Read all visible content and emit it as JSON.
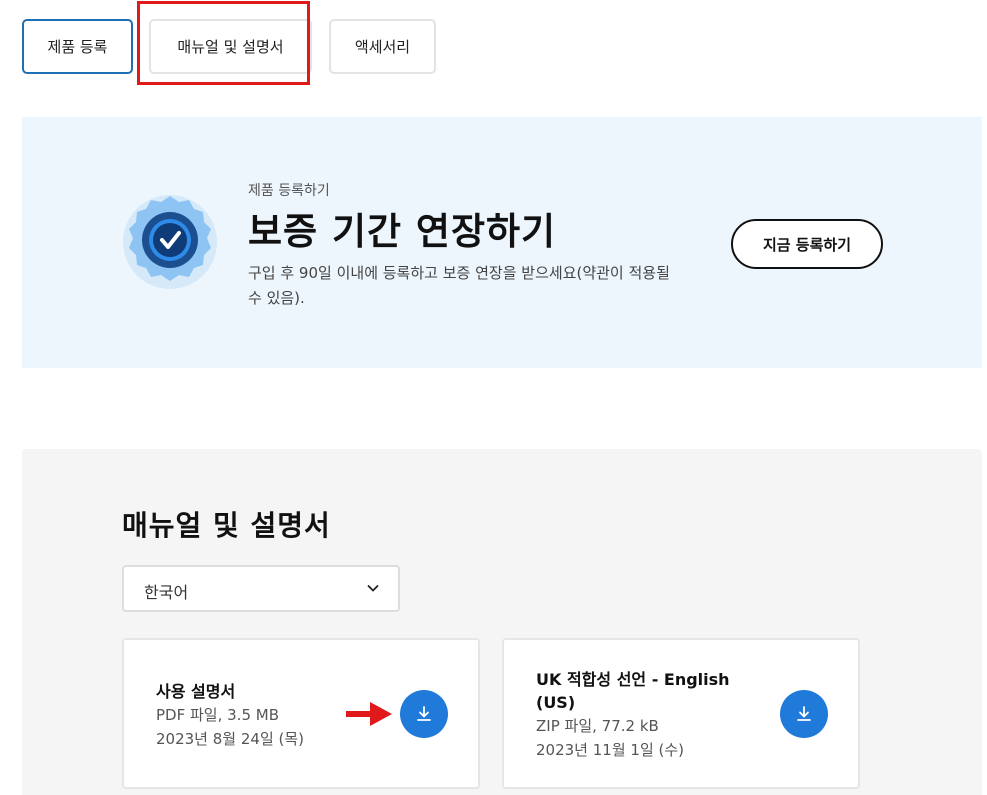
{
  "tabs": [
    {
      "label": "제품 등록",
      "active": true
    },
    {
      "label": "매뉴얼 및 설명서",
      "active": false
    },
    {
      "label": "액세서리",
      "active": false
    }
  ],
  "promo": {
    "eyebrow": "제품 등록하기",
    "title": "보증 기간 연장하기",
    "description": "구입 후 90일 이내에 등록하고 보증 연장을 받으세요(약관이 적용될 수 있음).",
    "button_label": "지금 등록하기",
    "badge_icon": "verified-check-icon"
  },
  "manuals": {
    "title": "매뉴얼 및 설명서",
    "language_select": {
      "value": "한국어",
      "icon": "chevron-down-icon"
    },
    "documents": [
      {
        "title": "사용 설명서",
        "file_info": "PDF 파일, 3.5 MB",
        "date": "2023년 8월 24일 (목)",
        "icon": "download-icon"
      },
      {
        "title": "UK 적합성 선언 - English (US)",
        "file_info": "ZIP 파일, 77.2 kB",
        "date": "2023년 11월 1일 (수)",
        "icon": "download-icon"
      }
    ]
  },
  "colors": {
    "accent": "#1f7ad9",
    "annotation_red": "#e0191b",
    "promo_bg": "#eef6fd",
    "section_bg": "#f5f5f5"
  }
}
